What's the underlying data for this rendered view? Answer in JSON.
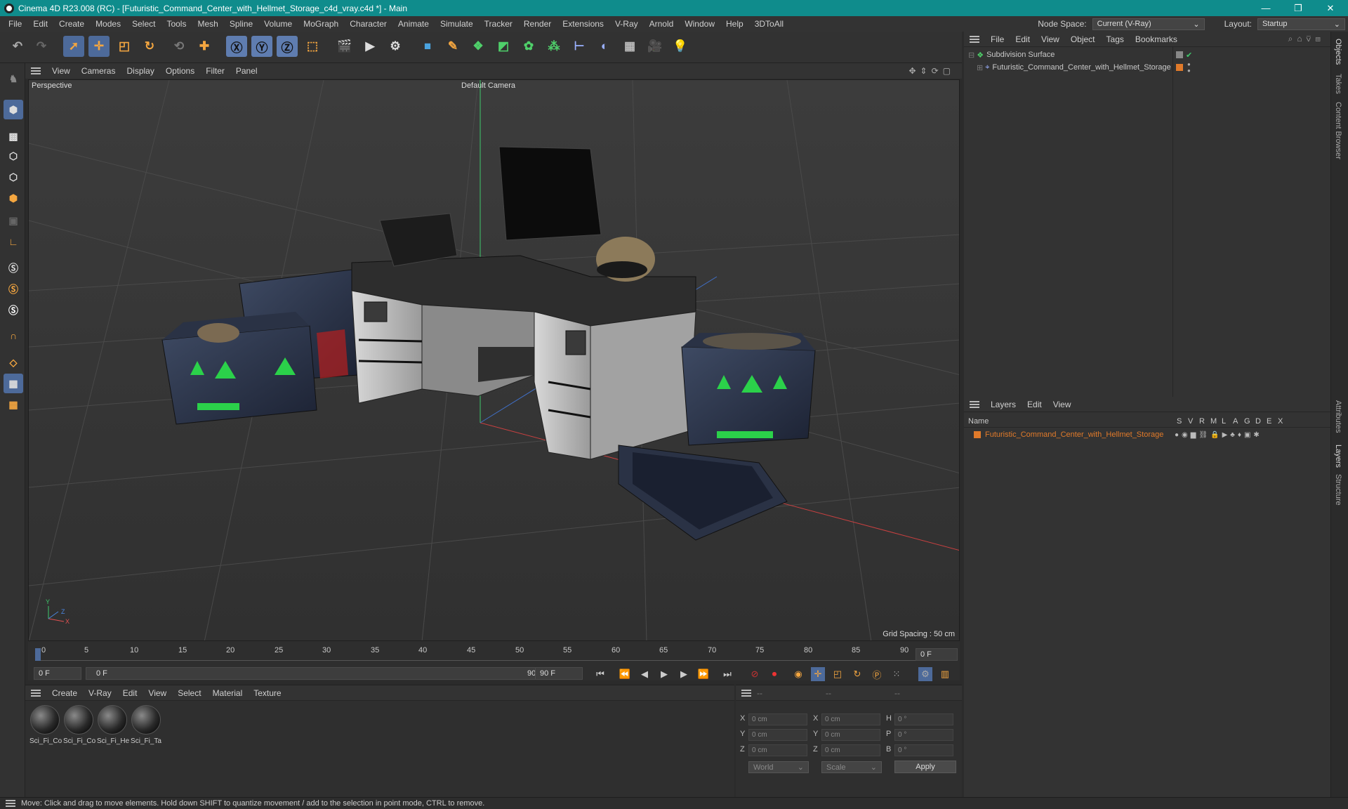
{
  "window": {
    "title": "Cinema 4D R23.008 (RC) - [Futuristic_Command_Center_with_Hellmet_Storage_c4d_vray.c4d *] - Main",
    "minimize": "—",
    "maximize": "❐",
    "close": "✕"
  },
  "menubar": {
    "items": [
      "File",
      "Edit",
      "Create",
      "Modes",
      "Select",
      "Tools",
      "Mesh",
      "Spline",
      "Volume",
      "MoGraph",
      "Character",
      "Animate",
      "Simulate",
      "Tracker",
      "Render",
      "Extensions",
      "V-Ray",
      "Arnold",
      "Window",
      "Help",
      "3DToAll"
    ],
    "node_space_label": "Node Space:",
    "node_space_value": "Current (V-Ray)",
    "layout_label": "Layout:",
    "layout_value": "Startup"
  },
  "viewport": {
    "menu": [
      "View",
      "Cameras",
      "Display",
      "Options",
      "Filter",
      "Panel"
    ],
    "name": "Perspective",
    "camera": "Default Camera",
    "grid_spacing": "Grid Spacing : 50 cm",
    "axis_y": "Y",
    "axis_z": "Z",
    "axis_x": "X"
  },
  "timeline": {
    "ticks": [
      "0",
      "5",
      "10",
      "15",
      "20",
      "25",
      "30",
      "35",
      "40",
      "45",
      "50",
      "55",
      "60",
      "65",
      "70",
      "75",
      "80",
      "85",
      "90"
    ],
    "current_frame_right": "0 F",
    "start_field": "0 F",
    "range_start": "0 F",
    "range_end": "90 F",
    "end_field": "90 F"
  },
  "materials": {
    "menu": [
      "Create",
      "V-Ray",
      "Edit",
      "View",
      "Select",
      "Material",
      "Texture"
    ],
    "items": [
      "Sci_Fi_Co",
      "Sci_Fi_Co",
      "Sci_Fi_He",
      "Sci_Fi_Ta"
    ]
  },
  "coords": {
    "header": [
      "--",
      "--",
      "--"
    ],
    "rows": [
      {
        "l1": "X",
        "v1": "0 cm",
        "l2": "X",
        "v2": "0 cm",
        "l3": "H",
        "v3": "0 °"
      },
      {
        "l1": "Y",
        "v1": "0 cm",
        "l2": "Y",
        "v2": "0 cm",
        "l3": "P",
        "v3": "0 °"
      },
      {
        "l1": "Z",
        "v1": "0 cm",
        "l2": "Z",
        "v2": "0 cm",
        "l3": "B",
        "v3": "0 °"
      }
    ],
    "mode": "World",
    "type": "Scale",
    "apply": "Apply"
  },
  "objects": {
    "menu": [
      "File",
      "Edit",
      "View",
      "Object",
      "Tags",
      "Bookmarks"
    ],
    "tree": [
      "Subdivision Surface",
      "Futuristic_Command_Center_with_Hellmet_Storage"
    ]
  },
  "layers": {
    "menu": [
      "Layers",
      "Edit",
      "View"
    ],
    "name_col": "Name",
    "flag_cols": [
      "S",
      "V",
      "R",
      "M",
      "L",
      "A",
      "G",
      "D",
      "E",
      "X"
    ],
    "rows": [
      "Futuristic_Command_Center_with_Hellmet_Storage"
    ]
  },
  "right_tabs": [
    "Objects",
    "Takes",
    "Content Browser",
    "Attributes",
    "Layers",
    "Structure"
  ],
  "status": "Move: Click and drag to move elements. Hold down SHIFT to quantize movement / add to the selection in point mode, CTRL to remove.",
  "colors": {
    "accent": "#0f8c8c",
    "orange": "#e07a2a",
    "active": "#4d6a9a"
  }
}
